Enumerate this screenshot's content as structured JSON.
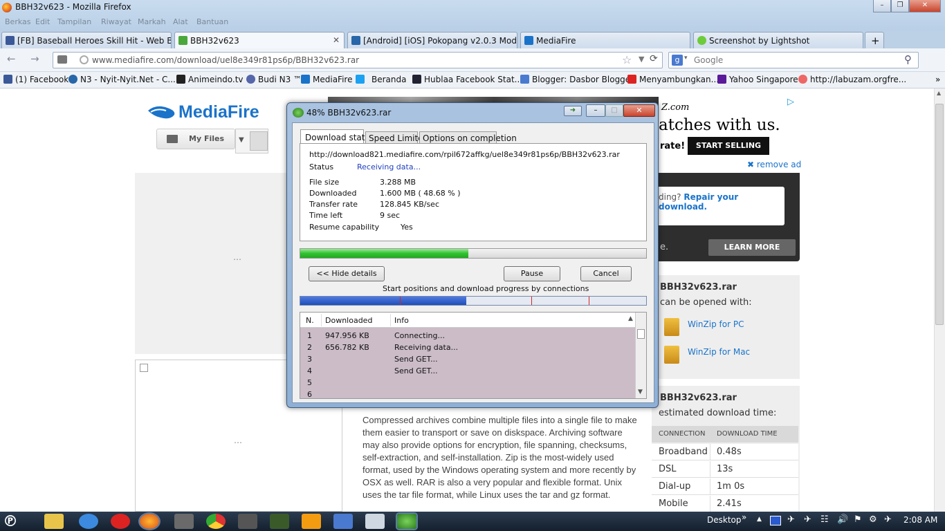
{
  "window": {
    "title": "BBH32v623 - Mozilla Firefox"
  },
  "menu": [
    "Berkas",
    "Edit",
    "Tampilan",
    "Riwayat",
    "Markah",
    "Alat",
    "Bantuan"
  ],
  "tabs": [
    {
      "label": "[FB] Baseball Heroes Skill Hit - Web B..."
    },
    {
      "label": "BBH32v623"
    },
    {
      "label": "[Android] [iOS] Pokopang v2.0.3 Mod..."
    },
    {
      "label": "MediaFire"
    },
    {
      "label": "Screenshot by Lightshot"
    }
  ],
  "new_tab": "+",
  "url": "www.mediafire.com/download/uel8e349r81ps6p/BBH32v623.rar",
  "search": {
    "placeholder": "Google"
  },
  "bookmarks": [
    "(1) Facebook",
    "N3 - Nyit-Nyit.Net - C...",
    "Animeindo.tv",
    "Budi N3 ™",
    "MediaFire",
    "Beranda",
    "Hublaa Facebook Stat...",
    "Blogger: Dasbor Blogger",
    "Menyambungkan...",
    "Yahoo Singapore",
    "http://labuzam.orgfre..."
  ],
  "page": {
    "logo": "MediaFire",
    "myfiles": "My Files",
    "ad_domain": "Z.com",
    "ad_line": "atches with us.",
    "ad_rate": "rate!",
    "start_selling": "START SELLING",
    "remove_ad": "remove ad",
    "repair_prefix": "ding?",
    "repair_link": "Repair your download.",
    "learn_prefix": "e.",
    "learn_more": "LEARN MORE",
    "file1_title": "BBH32v623.rar",
    "file1_sub": "can be opened with:",
    "winzip_pc": "WinZip for PC",
    "winzip_mac": "WinZip for Mac",
    "file2_title": "BBH32v623.rar",
    "file2_sub": "estimated download time:",
    "table_headers": [
      "CONNECTION",
      "DOWNLOAD TIME"
    ],
    "table_rows": [
      [
        "Broadband",
        "0.48s"
      ],
      [
        "DSL",
        "13s"
      ],
      [
        "Dial-up",
        "1m 0s"
      ],
      [
        "Mobile",
        "2.41s"
      ]
    ],
    "description": "Compressed archives combine multiple files into a single file to make them easier to transport or save on diskspace. Archiving software may also provide options for encryption, file spanning, checksums, self-extraction, and self-installation. Zip is the most-widely used format, used by the Windows operating system and more recently by OSX as well. RAR is also a very popular and flexible format. Unix uses the tar file format, while Linux uses the tar and gz format."
  },
  "dialog": {
    "title": "48% BBH32v623.rar",
    "tabs": [
      "Download status",
      "Speed Limiter",
      "Options on completion"
    ],
    "url": "http://download821.mediafire.com/rpil672affkg/uel8e349r81ps6p/BBH32v623.rar",
    "status_label": "Status",
    "status_value": "Receiving data...",
    "file_size_label": "File size",
    "file_size": "3.288  MB",
    "downloaded_label": "Downloaded",
    "downloaded": "1.600  MB  ( 48.68 % )",
    "rate_label": "Transfer rate",
    "rate": "128.845  KB/sec",
    "time_label": "Time left",
    "time_left": "9 sec",
    "resume_label": "Resume capability",
    "resume": "Yes",
    "progress": 0.4868,
    "hide_details": "<< Hide details",
    "pause": "Pause",
    "cancel": "Cancel",
    "connections_caption": "Start positions and download progress by connections",
    "conn_headers": [
      "N.",
      "Downloaded",
      "Info"
    ],
    "connections": [
      {
        "n": "1",
        "downloaded": "947.956  KB",
        "info": "Connecting..."
      },
      {
        "n": "2",
        "downloaded": "656.782  KB",
        "info": "Receiving data..."
      },
      {
        "n": "3",
        "downloaded": "",
        "info": "Send GET..."
      },
      {
        "n": "4",
        "downloaded": "",
        "info": "Send GET..."
      },
      {
        "n": "5",
        "downloaded": "",
        "info": ""
      },
      {
        "n": "6",
        "downloaded": "",
        "info": ""
      }
    ]
  },
  "taskbar": {
    "desktop": "Desktop",
    "chevron": "»",
    "time": "2:08 AM"
  },
  "colors": {
    "accent": "#1a73c9",
    "progress": "#2fc22f",
    "conn": "#1f4fb8"
  }
}
